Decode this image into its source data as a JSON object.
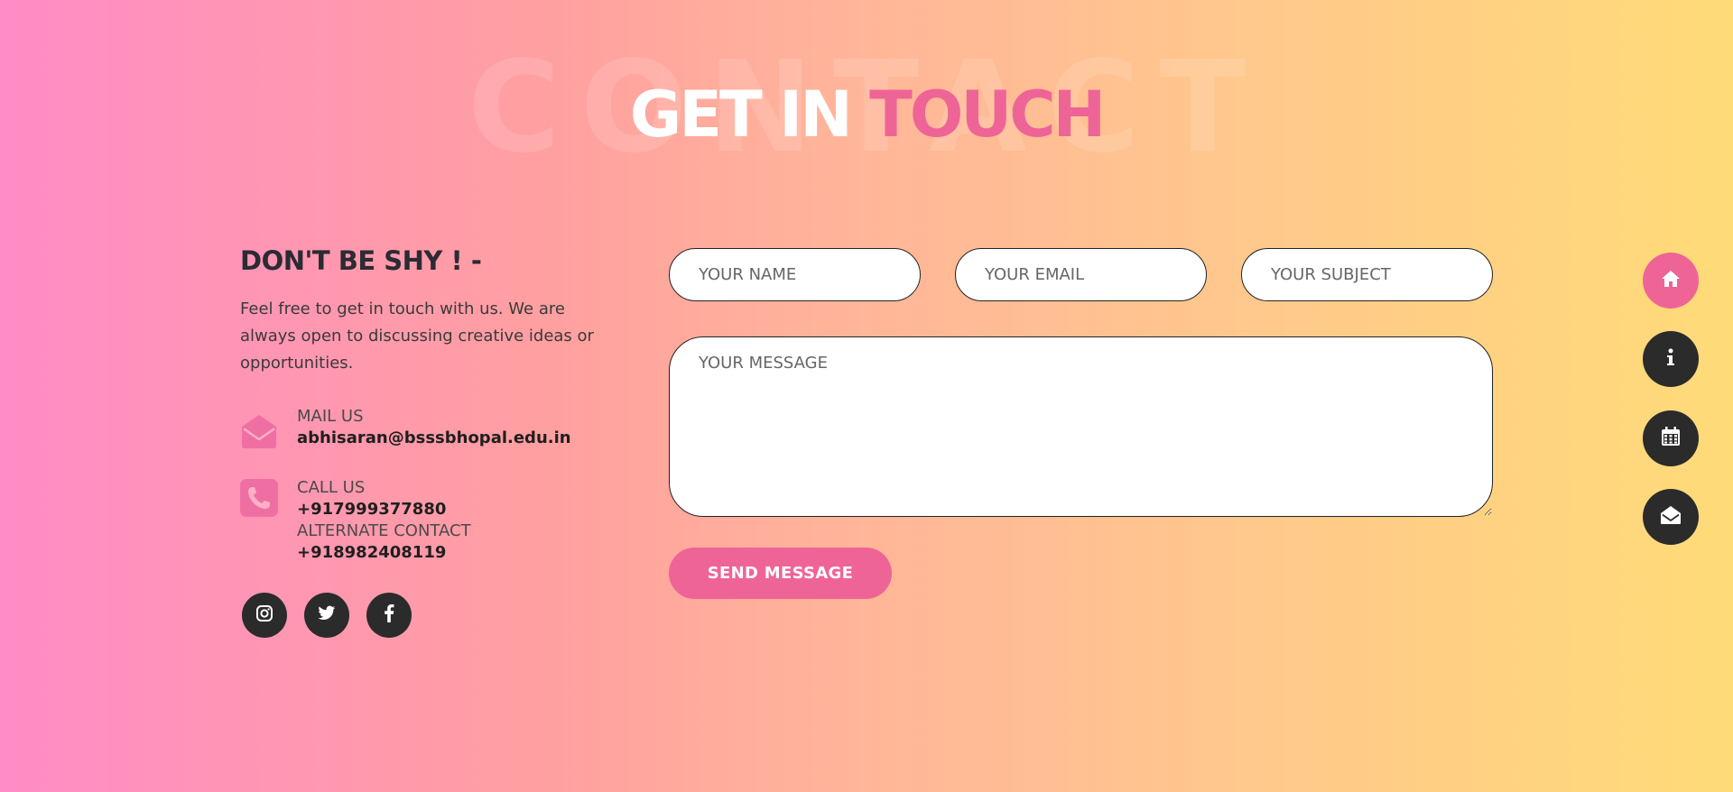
{
  "background_word": "CONTACT",
  "heading": {
    "part1": "GET IN",
    "part2": "TOUCH"
  },
  "intro": {
    "title": "DON'T BE SHY ! -",
    "text": "Feel free to get in touch with us. We are always open to discussing creative ideas or opportunities."
  },
  "contacts": {
    "mail": {
      "icon": "envelope-open-icon",
      "label": "MAIL US",
      "value": "abhisaran@bsssbhopal.edu.in"
    },
    "call": {
      "icon": "phone-icon",
      "label": "CALL US",
      "value": "+917999377880",
      "alt_label": "ALTERNATE CONTACT",
      "alt_value": "+918982408119"
    }
  },
  "social": [
    {
      "icon": "instagram-icon"
    },
    {
      "icon": "twitter-icon"
    },
    {
      "icon": "facebook-icon"
    }
  ],
  "form": {
    "name_placeholder": "YOUR NAME",
    "email_placeholder": "YOUR EMAIL",
    "subject_placeholder": "YOUR SUBJECT",
    "message_placeholder": "YOUR MESSAGE",
    "name_value": "",
    "email_value": "",
    "subject_value": "",
    "message_value": "",
    "send_label": "SEND MESSAGE"
  },
  "side_nav": [
    {
      "icon": "home-icon",
      "active": true
    },
    {
      "icon": "info-icon",
      "active": false
    },
    {
      "icon": "calendar-icon",
      "active": false
    },
    {
      "icon": "envelope-open-icon",
      "active": false
    }
  ],
  "colors": {
    "accent": "#ef6496",
    "dark": "#2b2b2b",
    "gradient_start": "#ff8cc6",
    "gradient_end": "#ffdb78"
  }
}
